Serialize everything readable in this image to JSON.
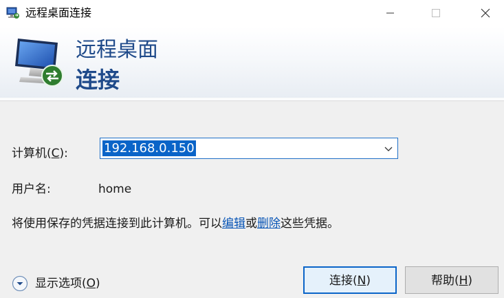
{
  "window": {
    "title": "远程桌面连接",
    "icon": "remote-desktop-icon"
  },
  "banner": {
    "line1": "远程桌面",
    "line2": "连接",
    "icon": "remote-desktop-monitor-icon"
  },
  "form": {
    "computer_label_prefix": "计算机(",
    "computer_label_key": "C",
    "computer_label_suffix": "):",
    "computer_value": "192.168.0.150",
    "user_label": "用户名:",
    "user_value": "home"
  },
  "note": {
    "text_before": "将使用保存的凭据连接到此计算机。可以",
    "edit_link": "编辑",
    "or": "或",
    "delete_link": "删除",
    "text_after": "这些凭据。"
  },
  "options": {
    "label_prefix": "显示选项(",
    "label_key": "O",
    "label_suffix": ")"
  },
  "buttons": {
    "connect_prefix": "连接(",
    "connect_key": "N",
    "connect_suffix": ")",
    "help_prefix": "帮助(",
    "help_key": "H",
    "help_suffix": ")"
  },
  "colors": {
    "accent": "#0a64c8",
    "banner_text": "#1f4a8a",
    "link": "#0a56b6"
  }
}
